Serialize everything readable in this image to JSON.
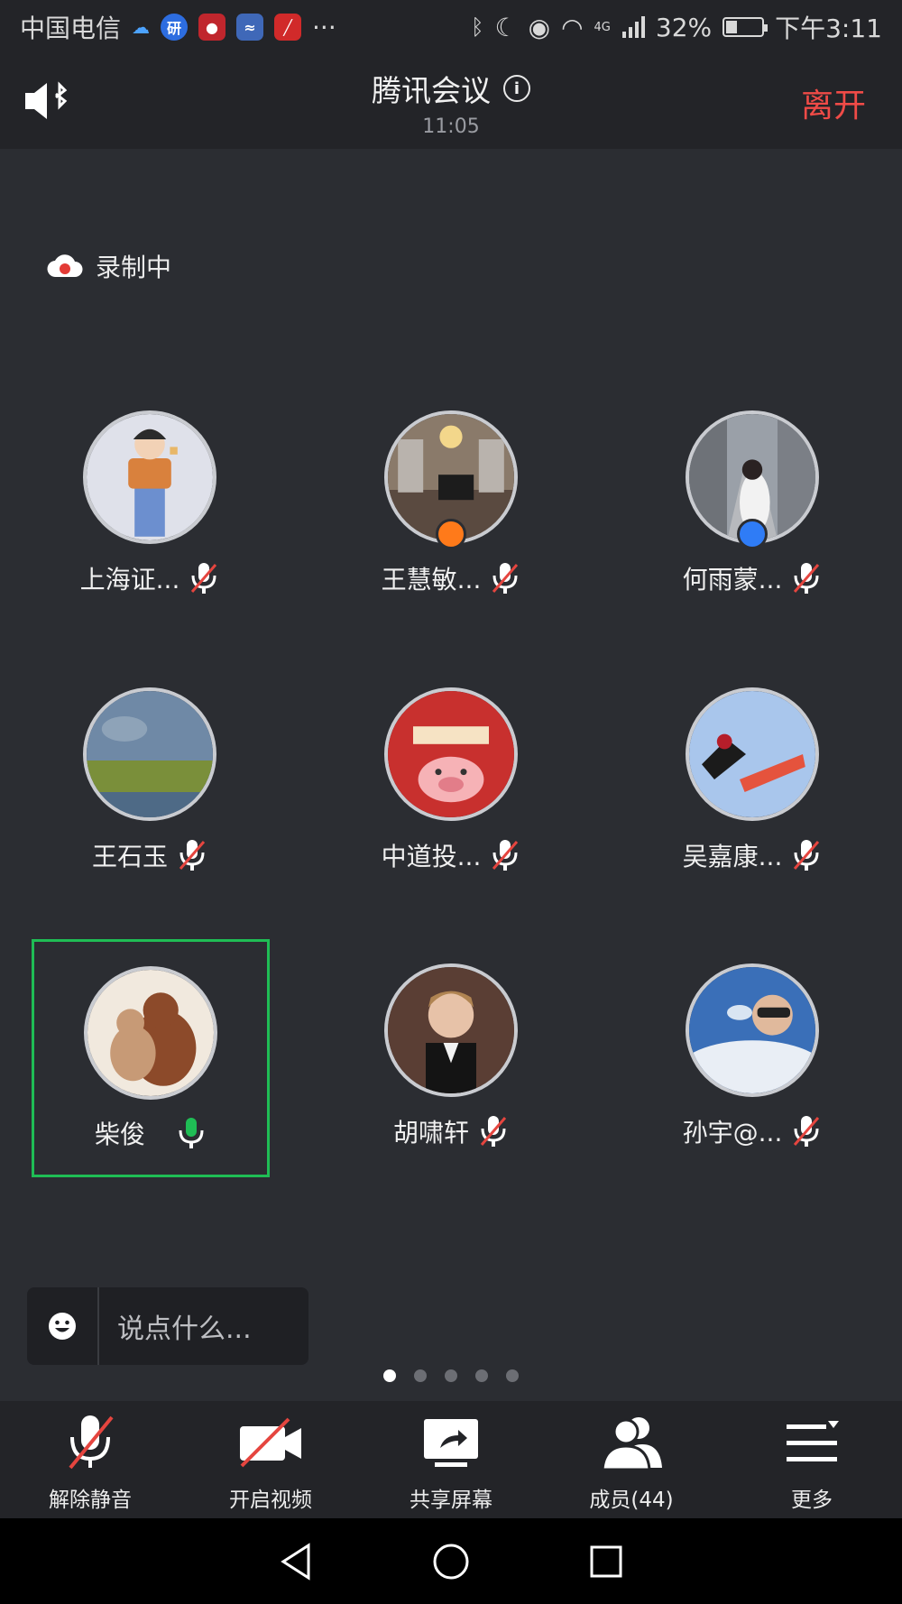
{
  "status_bar": {
    "carrier": "中国电信",
    "network": "4G",
    "battery": "32%",
    "battery_level": 0.32,
    "time": "下午3:11",
    "more": "···"
  },
  "header": {
    "title": "腾讯会议",
    "timer": "11:05",
    "leave_label": "离开"
  },
  "recording_label": "录制中",
  "participants": [
    {
      "name": "上海证...",
      "muted": true,
      "badge": null
    },
    {
      "name": "王慧敏...",
      "muted": true,
      "badge": "#ff7a1a"
    },
    {
      "name": "何雨蒙...",
      "muted": true,
      "badge": "#2f7cf6"
    },
    {
      "name": "王石玉",
      "muted": true,
      "badge": null
    },
    {
      "name": "中道投...",
      "muted": true,
      "badge": null
    },
    {
      "name": "吴嘉康...",
      "muted": true,
      "badge": null
    },
    {
      "name": "柴俊",
      "muted": false,
      "badge": null,
      "active": true
    },
    {
      "name": "胡啸轩",
      "muted": true,
      "badge": null
    },
    {
      "name": "孙宇@...",
      "muted": true,
      "badge": null
    }
  ],
  "chat": {
    "placeholder": "说点什么..."
  },
  "pagination": {
    "pages": 5,
    "current": 1
  },
  "toolbar": {
    "unmute_label": "解除静音",
    "video_label": "开启视频",
    "share_label": "共享屏幕",
    "members_label": "成员(44)",
    "more_label": "更多"
  },
  "colors": {
    "accent_green": "#1fbd55",
    "leave_red": "#f04b47",
    "mute_red": "#e5453f"
  }
}
